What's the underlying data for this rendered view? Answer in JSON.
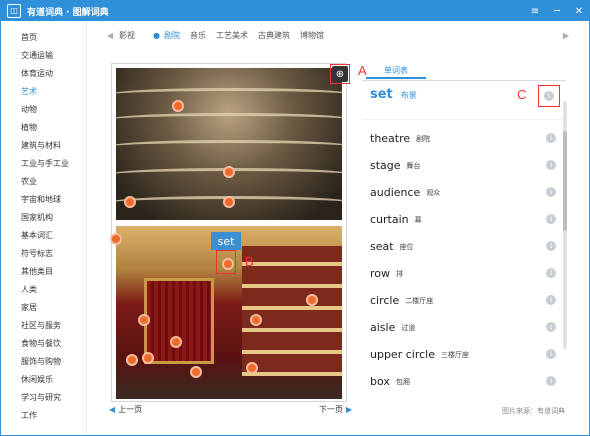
{
  "window": {
    "title": "有道词典 · 图解词典",
    "icon": "dictionary-app-icon"
  },
  "controls": [
    "≡",
    "─",
    "✕"
  ],
  "sidebar": {
    "items": [
      "首页",
      "交通运输",
      "体育运动",
      "艺术",
      "动物",
      "植物",
      "建筑与材料",
      "工业与手工业",
      "农业",
      "宇宙和地球",
      "国家机构",
      "基本词汇",
      "符号标志",
      "其他类目",
      "人类",
      "家居",
      "社区与服务",
      "食物与餐饮",
      "服饰与购物",
      "休闲娱乐",
      "学习与研究",
      "工作"
    ],
    "active_index": 3
  },
  "topnav": {
    "items": [
      "影视",
      "剧院",
      "音乐",
      "工艺美术",
      "古典建筑",
      "博物馆"
    ],
    "active_index": 1
  },
  "image": {
    "zoom_icon": "zoom-in-icon",
    "tag_label": "set",
    "callouts": {
      "a": "A",
      "b": "B",
      "c": "C"
    }
  },
  "pager": {
    "prev": "上一页",
    "next": "下一页"
  },
  "wordlist": {
    "tab": "单词表",
    "headword": {
      "en": "set",
      "zh": "布景"
    },
    "words": [
      {
        "en": "theatre",
        "zh": "剧院"
      },
      {
        "en": "stage",
        "zh": "舞台"
      },
      {
        "en": "audience",
        "zh": "观众"
      },
      {
        "en": "curtain",
        "zh": "幕"
      },
      {
        "en": "seat",
        "zh": "座位"
      },
      {
        "en": "row",
        "zh": "排"
      },
      {
        "en": "circle",
        "zh": "二楼厅座"
      },
      {
        "en": "aisle",
        "zh": "过道"
      },
      {
        "en": "upper circle",
        "zh": "三楼厅座"
      },
      {
        "en": "box",
        "zh": "包厢"
      }
    ],
    "info_icon": "info-icon"
  },
  "source": "图片来源：有道词典",
  "colors": {
    "accent": "#2f8fd8",
    "hotspot": "#f06a2c",
    "callout": "#e33333"
  }
}
